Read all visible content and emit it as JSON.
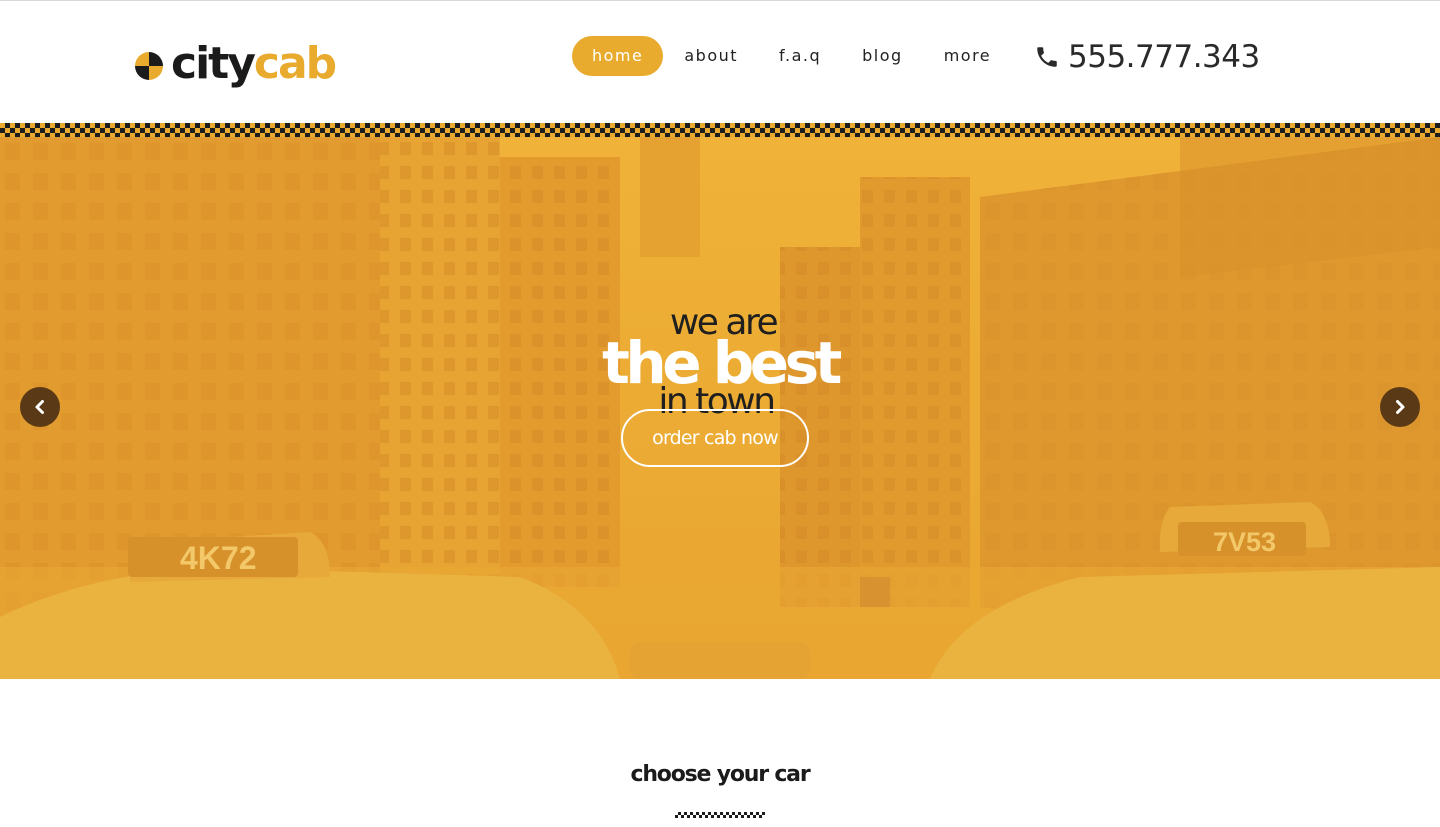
{
  "brand": {
    "name_part1": "city",
    "name_part2": "cab",
    "logo_icon": "checkered-circle-icon",
    "accent_color": "#e9ab2e",
    "dark_color": "#1b1b1b"
  },
  "nav": {
    "items": [
      {
        "label": "home",
        "active": true
      },
      {
        "label": "about",
        "active": false
      },
      {
        "label": "f.a.q",
        "active": false
      },
      {
        "label": "blog",
        "active": false
      },
      {
        "label": "more",
        "active": false
      }
    ]
  },
  "contact": {
    "phone_icon": "phone-icon",
    "phone": "555.777.343"
  },
  "hero": {
    "tagline_top": "we are",
    "tagline_main": "the best",
    "tagline_bottom": "in town",
    "cta_label": "order cab now",
    "prev_icon": "chevron-left-icon",
    "next_icon": "chevron-right-icon",
    "image_plates": [
      "4K72",
      "7V53"
    ]
  },
  "section": {
    "title": "choose your car"
  }
}
